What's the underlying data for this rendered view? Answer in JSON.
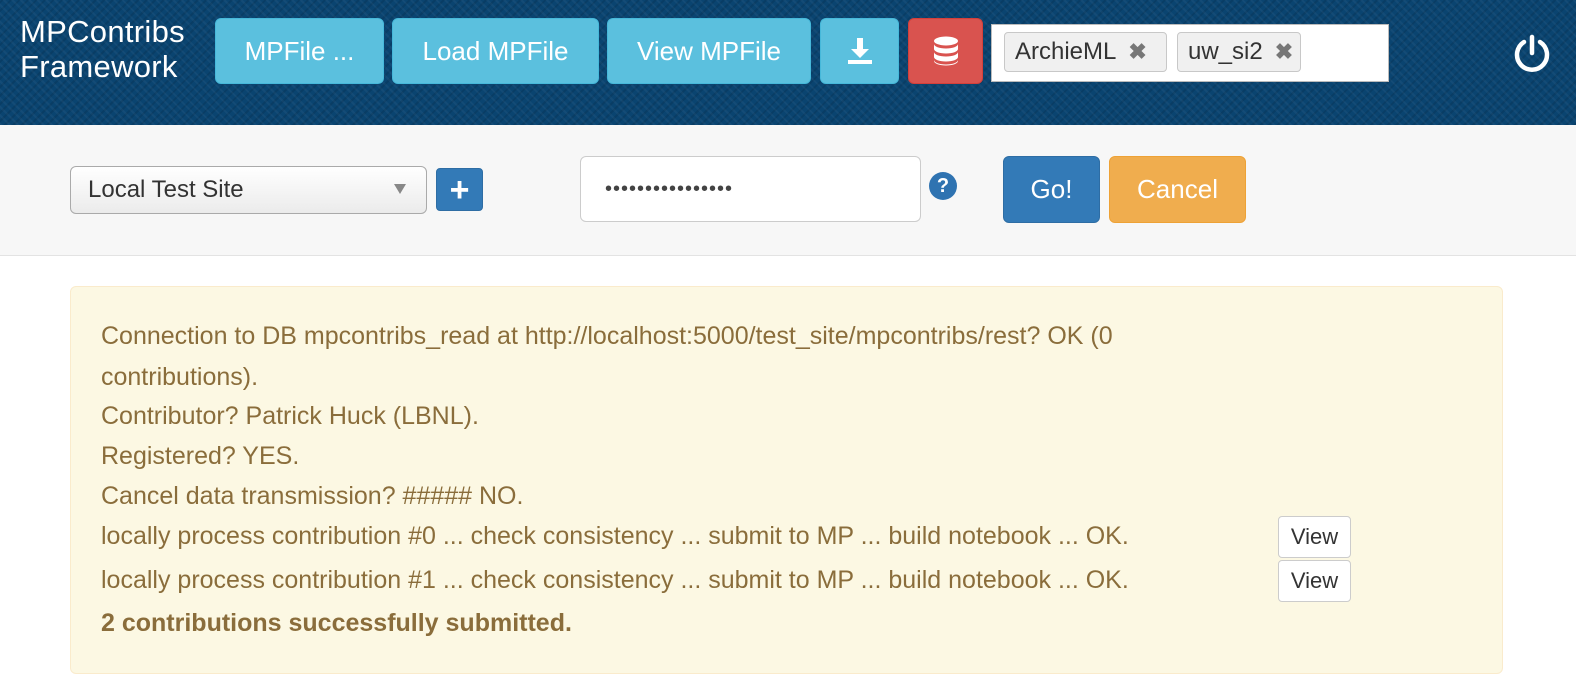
{
  "header": {
    "brand_line1": "MPContribs",
    "brand_line2": "Framework",
    "buttons": {
      "mpfile": "MPFile ...",
      "load": "Load MPFile",
      "view": "View MPFile"
    },
    "download_icon": "download-icon",
    "database_icon": "database-icon",
    "power_icon": "power-icon",
    "tags": [
      {
        "label": "ArchieML",
        "remove": "✖"
      },
      {
        "label": "uw_si2",
        "remove": "✖"
      }
    ]
  },
  "toolbar": {
    "site_select_value": "Local Test Site",
    "add_label": "+",
    "password_value": "••••••••••••••••",
    "help_label": "?",
    "go_label": "Go!",
    "cancel_label": "Cancel"
  },
  "log": {
    "line1a": "Connection to DB mpcontribs_read at http://localhost:5000/test_site/mpcontribs/rest? OK (0",
    "line1b": "contributions).",
    "line2": "Contributor? Patrick Huck (LBNL).",
    "line3": "Registered? YES.",
    "line4": "Cancel data transmission? ##### NO.",
    "line5": "locally process contribution #0 ... check consistency ... submit to MP ... build notebook ... OK.",
    "line6": "locally process contribution #1 ... check consistency ... submit to MP ... build notebook ... OK.",
    "view_label": "View",
    "summary": "2 contributions successfully submitted."
  },
  "colors": {
    "header_bg": "#0a4470",
    "info": "#5bc0de",
    "danger": "#d9534f",
    "primary": "#337ab7",
    "warning": "#f0ad4e",
    "alert_bg": "#fcf8e3",
    "alert_text": "#8a6d3b"
  }
}
